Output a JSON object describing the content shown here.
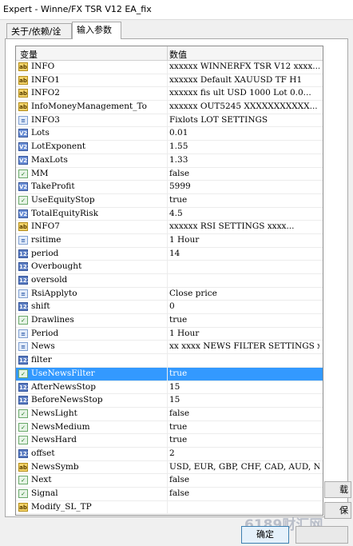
{
  "window": {
    "title": "Expert - Winne/FX TSR V12 EA_fix"
  },
  "tabs": [
    {
      "label": "关于/依赖/诠释"
    },
    {
      "label": "输入参数"
    }
  ],
  "grid": {
    "headers": {
      "variable": "变量",
      "value": "数值"
    },
    "rows": [
      {
        "icon": "ab",
        "name": "INFO",
        "value": "xxxxxx      WINNERFX TSR V12    xxxx..."
      },
      {
        "icon": "ab",
        "name": "INFO1",
        "value": "xxxxxx    Default XAUUSD TF   H1"
      },
      {
        "icon": "ab",
        "name": "INFO2",
        "value": "xxxxxx   fis ult USD 1000 Lot 0.0..."
      },
      {
        "icon": "ab",
        "name": "InfoMoneyManagement_To",
        "value": "xxxxxx    OUT5245      XXXXXXXXXXX..."
      },
      {
        "icon": "list",
        "name": "INFO3",
        "value": "Fixlots              LOT SETTINGS"
      },
      {
        "icon": "v2",
        "name": "Lots",
        "value": "0.01"
      },
      {
        "icon": "v2",
        "name": "LotExponent",
        "value": "1.55"
      },
      {
        "icon": "v2",
        "name": "MaxLots",
        "value": "1.33"
      },
      {
        "icon": "chk",
        "name": "MM",
        "value": "false"
      },
      {
        "icon": "v2",
        "name": "TakeProfit",
        "value": "5999"
      },
      {
        "icon": "chk",
        "name": "UseEquityStop",
        "value": "true"
      },
      {
        "icon": "v2",
        "name": "TotalEquityRisk",
        "value": "4.5"
      },
      {
        "icon": "ab",
        "name": "INFO7",
        "value": "xxxxxx       RSI SETTINGS       xxxx..."
      },
      {
        "icon": "list",
        "name": "rsitime",
        "value": "1 Hour"
      },
      {
        "icon": "v123",
        "name": "period",
        "value": "14"
      },
      {
        "icon": "v123",
        "name": "Overbought",
        "value": ""
      },
      {
        "icon": "v123",
        "name": "oversold",
        "value": ""
      },
      {
        "icon": "list",
        "name": "RsiApplyto",
        "value": "Close price"
      },
      {
        "icon": "v123",
        "name": "shift",
        "value": "0"
      },
      {
        "icon": "chk",
        "name": "Drawlines",
        "value": "true"
      },
      {
        "icon": "list",
        "name": "Period",
        "value": "1 Hour"
      },
      {
        "icon": "list",
        "name": "News",
        "value": "xx  xxxx  NEWS FILTER SETTINGS  xxx..."
      },
      {
        "icon": "v123",
        "name": "filter",
        "value": ""
      },
      {
        "icon": "chk",
        "name": "UseNewsFilter",
        "value": "true",
        "selected": true
      },
      {
        "icon": "v123",
        "name": "AfterNewsStop",
        "value": "15"
      },
      {
        "icon": "v123",
        "name": "BeforeNewsStop",
        "value": "15"
      },
      {
        "icon": "chk",
        "name": "NewsLight",
        "value": "false"
      },
      {
        "icon": "chk",
        "name": "NewsMedium",
        "value": "true"
      },
      {
        "icon": "chk",
        "name": "NewsHard",
        "value": "true"
      },
      {
        "icon": "v123",
        "name": "offset",
        "value": "2"
      },
      {
        "icon": "ab",
        "name": "NewsSymb",
        "value": "USD, EUR, GBP, CHF, CAD, AUD, NZD, JPY"
      },
      {
        "icon": "chk",
        "name": "Next",
        "value": "false"
      },
      {
        "icon": "chk",
        "name": "Signal",
        "value": "false"
      },
      {
        "icon": "ab",
        "name": "Modify_SL_TP",
        "value": ""
      }
    ]
  },
  "buttons": {
    "ok": "确定",
    "cancel": "",
    "side1": "载",
    "side2": "保"
  },
  "watermark": "6189财汇网"
}
